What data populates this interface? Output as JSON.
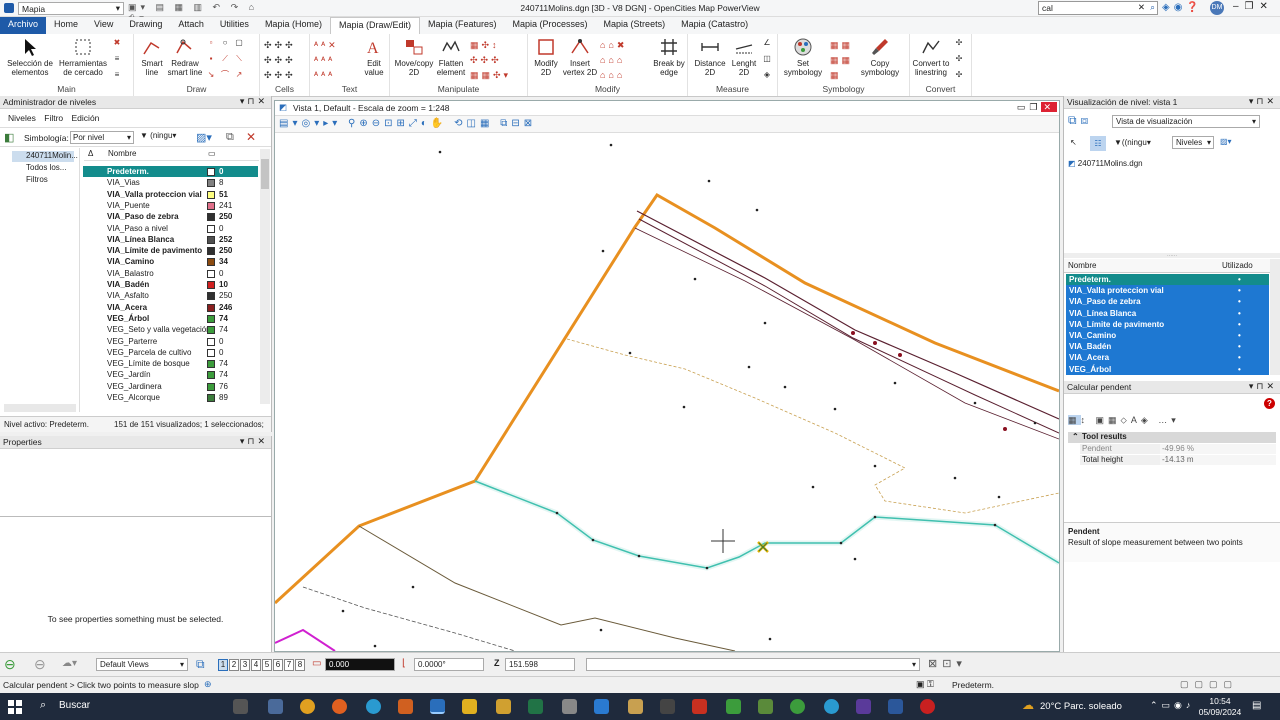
{
  "app": {
    "title": "240711Molins.dgn [3D - V8 DGN] - OpenCities Map PowerView",
    "workflow": "Mapia",
    "search_value": "cal",
    "user_initials": "DM"
  },
  "ribbon": {
    "tabs": [
      "Archivo",
      "Home",
      "View",
      "Drawing",
      "Attach",
      "Utilities",
      "Mapia (Home)",
      "Mapia (Draw/Edit)",
      "Mapia (Features)",
      "Mapia (Processes)",
      "Mapia (Streets)",
      "Mapia (Catastro)"
    ],
    "groups": [
      "Main",
      "Draw",
      "Cells",
      "Text",
      "Manipulate",
      "Modify",
      "Measure",
      "Symbology",
      "Convert"
    ],
    "buttons": {
      "seleccion": "Selección de elementos",
      "herramientas": "Herramientas de cercado",
      "smartline": "Smart line",
      "redraw": "Redraw smart line",
      "edittext": "Edit value",
      "movecopy": "Move/copy 2D",
      "flatten": "Flatten element",
      "modify2d": "Modify 2D",
      "insertvertex": "Insert vertex 2D",
      "break": "Break by edge",
      "distance": "Distance 2D",
      "lenght": "Lenght 2D",
      "setsym": "Set symbology",
      "copysym": "Copy symbology",
      "convert": "Convert to linestring"
    }
  },
  "levels": {
    "title": "Administrador de niveles",
    "menu": [
      "Niveles",
      "Filtro",
      "Edición"
    ],
    "symbology_label": "Simbología:",
    "symbology_value": "Por nivel",
    "filter_value": "(ningu",
    "tree": [
      "240711Molin...",
      "Todos los...",
      "Filtros"
    ],
    "col_name": "Nombre",
    "rows": [
      {
        "name": "Predeterm.",
        "num": "0",
        "color": "#ffffff",
        "bold": true,
        "sel": true
      },
      {
        "name": "VIA_Vias",
        "num": "8",
        "color": "#808080",
        "bold": false
      },
      {
        "name": "VIA_Valla proteccion vial",
        "num": "51",
        "color": "#ffff80",
        "bold": true
      },
      {
        "name": "VIA_Puente",
        "num": "241",
        "color": "#e0708a",
        "bold": false
      },
      {
        "name": "VIA_Paso de zebra",
        "num": "250",
        "color": "#303030",
        "bold": true
      },
      {
        "name": "VIA_Paso a nivel",
        "num": "0",
        "color": "#ffffff",
        "bold": false
      },
      {
        "name": "VIA_Línea Blanca",
        "num": "252",
        "color": "#505050",
        "bold": true
      },
      {
        "name": "VIA_Límite de pavimento",
        "num": "250",
        "color": "#303030",
        "bold": true
      },
      {
        "name": "VIA_Camino",
        "num": "34",
        "color": "#8b4a10",
        "bold": true
      },
      {
        "name": "VIA_Balastro",
        "num": "0",
        "color": "#ffffff",
        "bold": false
      },
      {
        "name": "VIA_Badén",
        "num": "10",
        "color": "#d02020",
        "bold": true
      },
      {
        "name": "VIA_Asfalto",
        "num": "250",
        "color": "#303030",
        "bold": false
      },
      {
        "name": "VIA_Acera",
        "num": "246",
        "color": "#8b2020",
        "bold": true
      },
      {
        "name": "VEG_Árbol",
        "num": "74",
        "color": "#3c9c3c",
        "bold": true
      },
      {
        "name": "VEG_Seto y valla vegetación",
        "num": "74",
        "color": "#3c9c3c",
        "bold": false
      },
      {
        "name": "VEG_Parterre",
        "num": "0",
        "color": "#ffffff",
        "bold": false
      },
      {
        "name": "VEG_Parcela de cultivo",
        "num": "0",
        "color": "#ffffff",
        "bold": false
      },
      {
        "name": "VEG_Límite de bosque",
        "num": "74",
        "color": "#3c9c3c",
        "bold": false
      },
      {
        "name": "VEG_Jardín",
        "num": "74",
        "color": "#3c9c3c",
        "bold": false
      },
      {
        "name": "VEG_Jardinera",
        "num": "76",
        "color": "#3c9c3c",
        "bold": false
      },
      {
        "name": "VEG_Alcorque",
        "num": "89",
        "color": "#3c7c3c",
        "bold": false
      }
    ],
    "status_active": "Nivel activo: Predeterm.",
    "status_count": "151 de 151 visualizados; 1 seleccionados;"
  },
  "properties": {
    "title": "Properties",
    "empty_msg": "To see properties something must be selected."
  },
  "view": {
    "title": "Vista 1, Default - Escala de zoom = 1:248"
  },
  "level_display": {
    "title": "Visualización de nivel: vista 1",
    "mode": "Vista de visualización",
    "filter": "(ningu",
    "levels_btn": "Niveles",
    "file": "240711Molins.dgn",
    "col_name": "Nombre",
    "col_used": "Utilizado",
    "rows": [
      "Predeterm.",
      "VIA_Valla proteccion vial",
      "VIA_Paso de zebra",
      "VIA_Línea Blanca",
      "VIA_Límite de pavimento",
      "VIA_Camino",
      "VIA_Badén",
      "VIA_Acera",
      "VEG_Árbol"
    ]
  },
  "calc": {
    "title": "Calcular pendent",
    "section": "Tool results",
    "r1_label": "Pendent",
    "r1_value": "-49.96 %",
    "r2_label": "Total height",
    "r2_value": "-14.13 m",
    "desc_title": "Pendent",
    "desc_text": "Result of slope measurement between two points"
  },
  "statusbar": {
    "views_label": "Default Views",
    "views": [
      "1",
      "2",
      "3",
      "4",
      "5",
      "6",
      "7",
      "8"
    ],
    "x_value": "0.000",
    "angle_value": "0.0000°",
    "z_label": "Z",
    "z_value": "151.598"
  },
  "message": {
    "prompt": "Calcular pendent > Click two points to measure slop",
    "active_level": "Predeterm."
  },
  "taskbar": {
    "search": "Buscar",
    "weather": "20°C  Parc. soleado",
    "time": "10:54",
    "date": "05/09/2024"
  }
}
